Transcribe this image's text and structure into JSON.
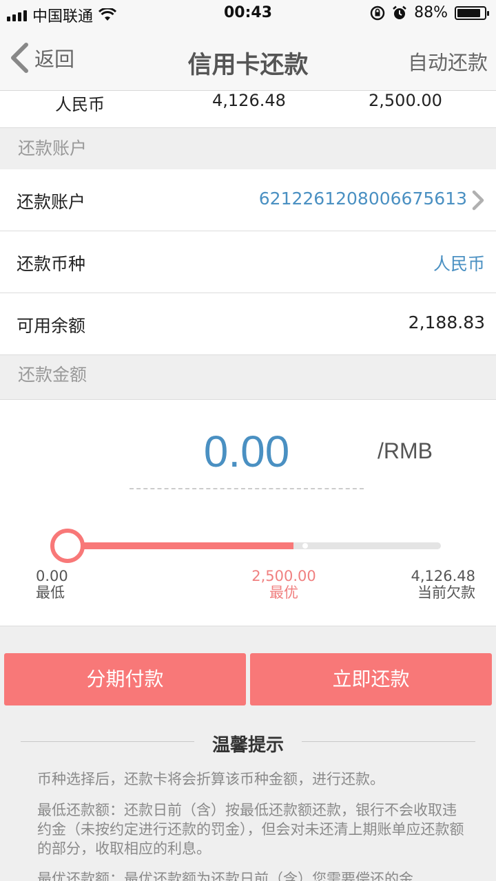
{
  "status_bar": {
    "carrier": "中国联通",
    "time": "00:43",
    "battery_percent": "88%",
    "battery_level": 0.88
  },
  "nav": {
    "back_label": "返回",
    "title": "信用卡还款",
    "right_action": "自动还款"
  },
  "currency_row": {
    "currency": "人民币",
    "current_debt": "4,126.48",
    "optimal": "2,500.00"
  },
  "repay_account_section": {
    "header": "还款账户",
    "rows": [
      {
        "label": "还款账户",
        "value": "6212261208006675613"
      },
      {
        "label": "还款币种",
        "value": "人民币"
      },
      {
        "label": "可用余额",
        "value": "2,188.83"
      }
    ]
  },
  "amount_section": {
    "header": "还款金额",
    "value": "0.00",
    "unit": "/RMB",
    "slider": {
      "min": 0,
      "max": 4126.48,
      "optimal": 2500.0,
      "current": 0,
      "min_value_text": "0.00",
      "min_label": "最低",
      "optimal_value_text": "2,500.00",
      "optimal_label": "最优",
      "max_value_text": "4,126.48",
      "max_label": "当前欠款"
    }
  },
  "buttons": {
    "installment": "分期付款",
    "repay_now": "立即还款"
  },
  "tips": {
    "title": "温馨提示",
    "items": [
      "币种选择后，还款卡将会折算该币种金额，进行还款。",
      "最低还款额：还款日前（含）按最低还款额还款，银行不会收取违约金（未按约定进行还款的罚金），但会对未还清上期账单应还款额的部分，收取相应的利息。",
      "最优还款额：最优还款额为还款日前（含）您需要偿还的金"
    ]
  },
  "colors": {
    "accent_red": "#f87878",
    "link_blue": "#4a90c2",
    "background": "#efefef"
  }
}
